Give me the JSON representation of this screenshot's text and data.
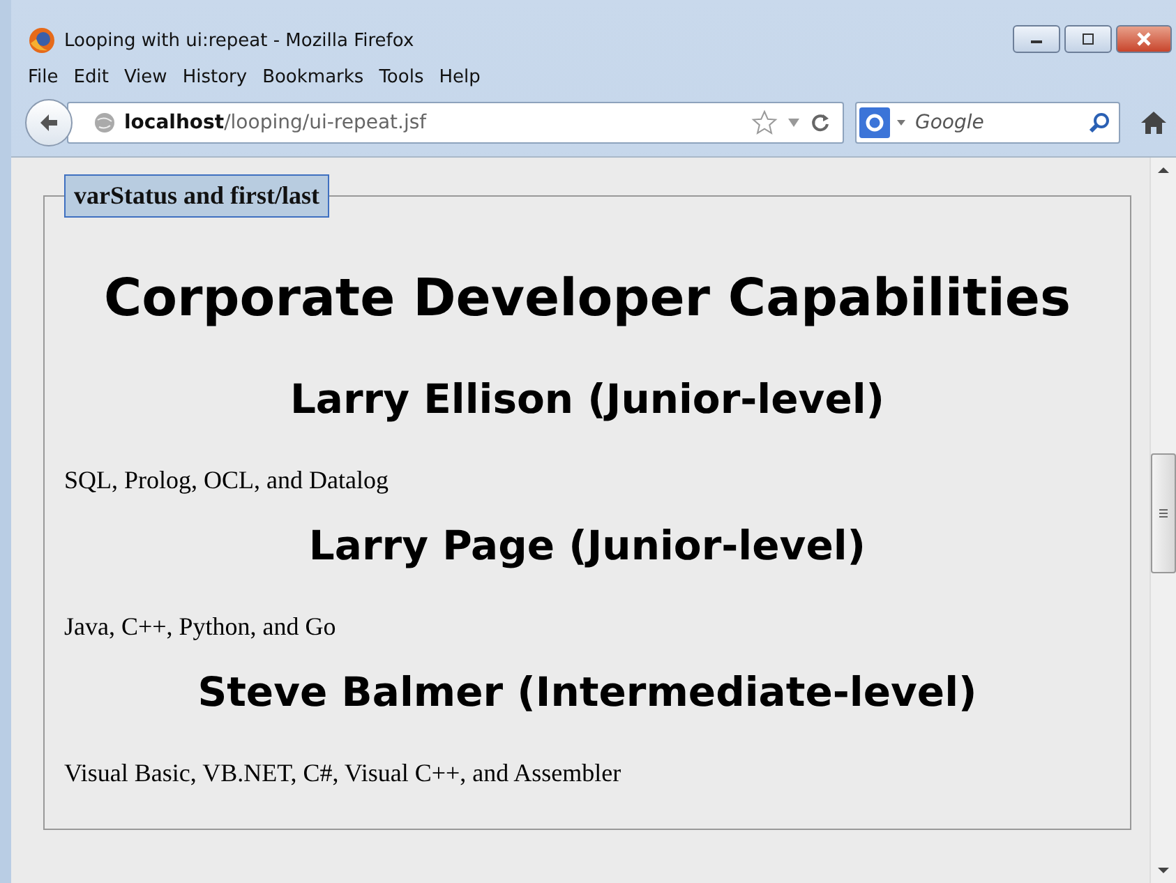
{
  "window": {
    "title": "Looping with ui:repeat - Mozilla Firefox"
  },
  "menu": [
    "File",
    "Edit",
    "View",
    "History",
    "Bookmarks",
    "Tools",
    "Help"
  ],
  "address_bar": {
    "host": "localhost",
    "path": "/looping/ui-repeat.jsf"
  },
  "search": {
    "placeholder": "Google"
  },
  "page": {
    "legend": "varStatus and first/last",
    "heading": "Corporate Developer Capabilities",
    "sections": [
      {
        "title": "Larry Ellison (Junior-level)",
        "text": "SQL, Prolog, OCL, and Datalog"
      },
      {
        "title": "Larry Page (Junior-level)",
        "text": "Java, C++, Python, and Go"
      },
      {
        "title": "Steve Balmer (Intermediate-level)",
        "text": "Visual Basic, VB.NET, C#, Visual C++, and Assembler"
      }
    ]
  }
}
